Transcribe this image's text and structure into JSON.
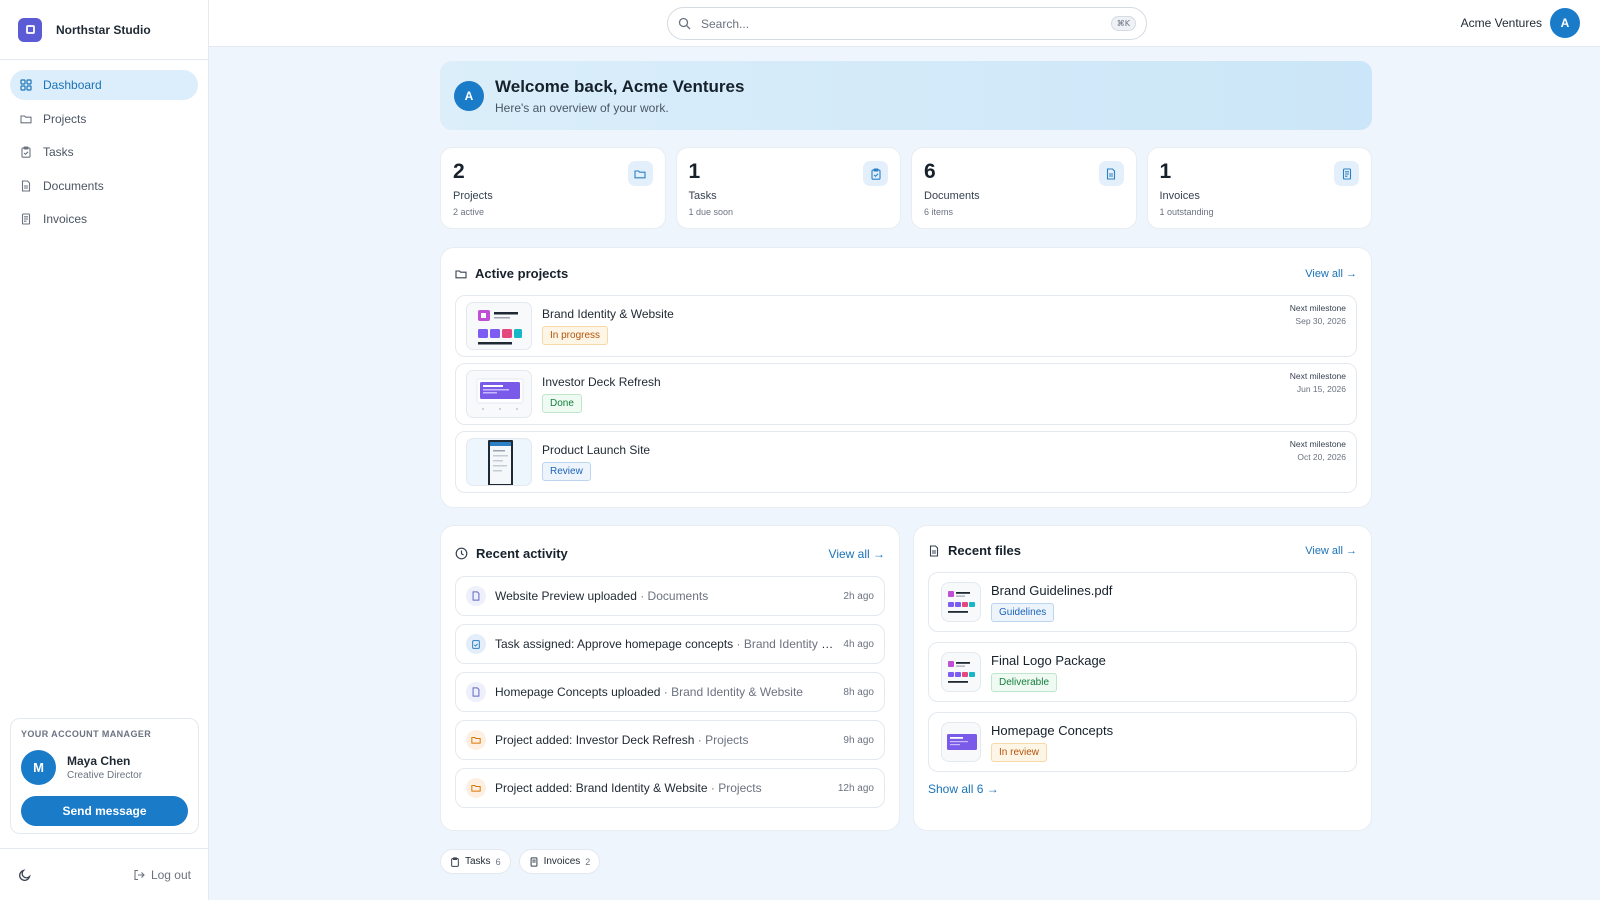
{
  "brand": {
    "name": "Northstar Studio"
  },
  "sidebar": {
    "items": [
      {
        "label": "Dashboard",
        "icon": "grid-icon"
      },
      {
        "label": "Projects",
        "icon": "folder-icon"
      },
      {
        "label": "Tasks",
        "icon": "clipboard-icon"
      },
      {
        "label": "Documents",
        "icon": "document-icon"
      },
      {
        "label": "Invoices",
        "icon": "receipt-icon"
      }
    ],
    "manager": {
      "title": "YOUR ACCOUNT MANAGER",
      "initial": "M",
      "name": "Maya Chen",
      "role": "Creative Director",
      "button": "Send message"
    },
    "logout": "Log out"
  },
  "topbar": {
    "search_placeholder": "Search...",
    "shortcut": "⌘K",
    "user_name": "Acme Ventures",
    "user_initial": "A"
  },
  "welcome": {
    "initial": "A",
    "title": "Welcome back, Acme Ventures",
    "subtitle": "Here's an overview of your work."
  },
  "stats": [
    {
      "value": "2",
      "label": "Projects",
      "sub": "2 active",
      "icon": "folder-icon"
    },
    {
      "value": "1",
      "label": "Tasks",
      "sub": "1 due soon",
      "icon": "clipboard-icon"
    },
    {
      "value": "6",
      "label": "Documents",
      "sub": "6 items",
      "icon": "document-icon"
    },
    {
      "value": "1",
      "label": "Invoices",
      "sub": "1 outstanding",
      "icon": "receipt-icon"
    }
  ],
  "projects": {
    "title": "Active projects",
    "view_all": "View all →",
    "milestone_label": "Next milestone",
    "items": [
      {
        "name": "Brand Identity & Website",
        "status": "In progress",
        "date": "Sep 30, 2026"
      },
      {
        "name": "Investor Deck Refresh",
        "status": "Done",
        "date": "Jun 15, 2026"
      },
      {
        "name": "Product Launch Site",
        "status": "Review",
        "date": "Oct 20, 2026"
      }
    ]
  },
  "activity": {
    "title": "Recent activity",
    "view_all": "View all →",
    "items": [
      {
        "text": "Website Preview uploaded",
        "context": "· Documents",
        "time": "2h ago",
        "icon": "document-icon"
      },
      {
        "text": "Task assigned: Approve homepage concepts",
        "context": "· Brand Identity & Website",
        "time": "4h ago",
        "icon": "clipboard-icon"
      },
      {
        "text": "Homepage Concepts uploaded",
        "context": "· Brand Identity & Website",
        "time": "8h ago",
        "icon": "document-icon"
      },
      {
        "text": "Project added: Investor Deck Refresh",
        "context": "· Projects",
        "time": "9h ago",
        "icon": "folder-icon"
      },
      {
        "text": "Project added: Brand Identity & Website",
        "context": "· Projects",
        "time": "12h ago",
        "icon": "folder-icon"
      }
    ]
  },
  "files": {
    "title": "Recent files",
    "view_all": "View all →",
    "show_all": "Show all 6 →",
    "items": [
      {
        "name": "Brand Guidelines.pdf",
        "tag": "Guidelines"
      },
      {
        "name": "Final Logo Package",
        "tag": "Deliverable"
      },
      {
        "name": "Homepage Concepts",
        "tag": "In review"
      }
    ]
  },
  "chips": [
    {
      "label": "Tasks",
      "count": "6"
    },
    {
      "label": "Invoices",
      "count": "2"
    }
  ],
  "colors": {
    "accent": "#1a7bc9",
    "brand": "#5b5bd6",
    "background": "#eef5fc"
  }
}
